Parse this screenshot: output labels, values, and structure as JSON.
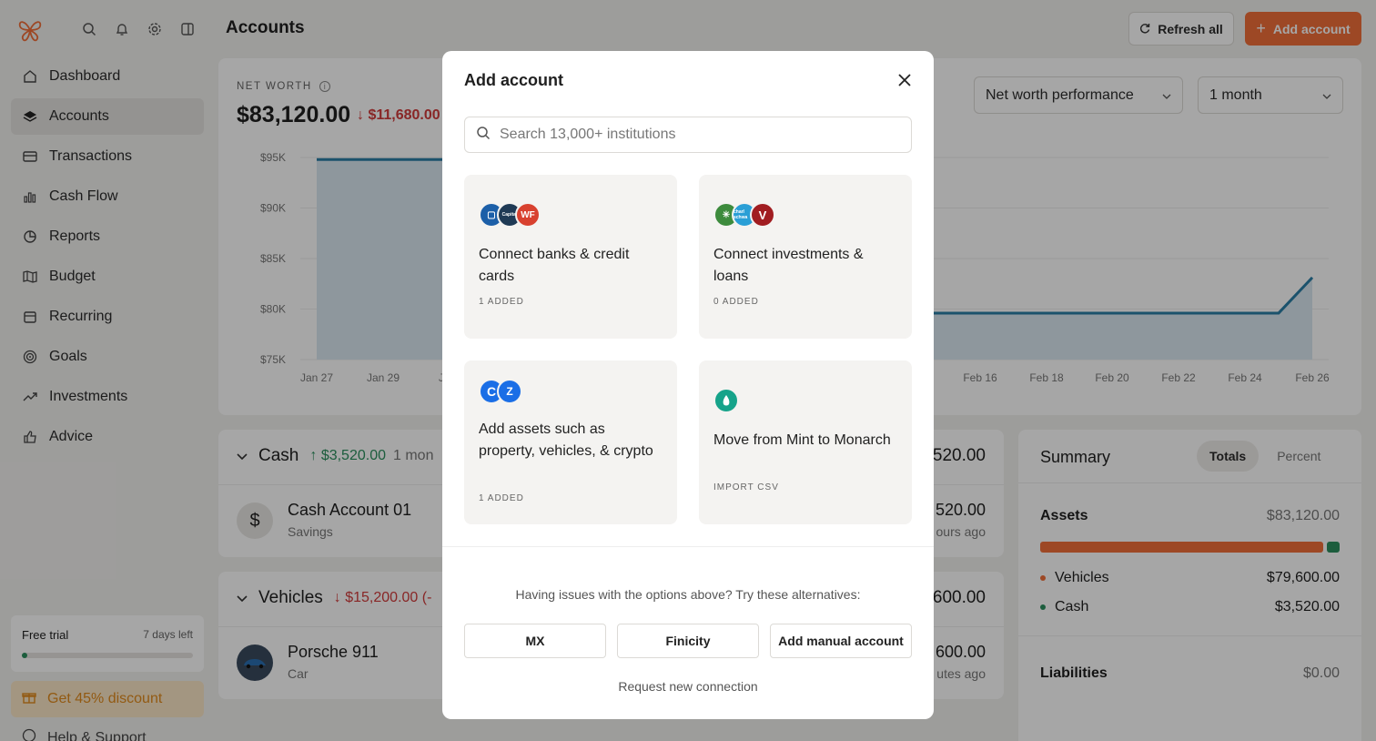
{
  "header": {
    "title": "Accounts",
    "refresh_label": "Refresh all",
    "add_label": "Add account"
  },
  "sidebar": {
    "items": [
      {
        "label": "Dashboard",
        "icon": "home-icon"
      },
      {
        "label": "Accounts",
        "icon": "layers-icon",
        "active": true
      },
      {
        "label": "Transactions",
        "icon": "credit-card-icon"
      },
      {
        "label": "Cash Flow",
        "icon": "bar-chart-icon"
      },
      {
        "label": "Reports",
        "icon": "pie-chart-icon"
      },
      {
        "label": "Budget",
        "icon": "map-icon"
      },
      {
        "label": "Recurring",
        "icon": "calendar-icon"
      },
      {
        "label": "Goals",
        "icon": "target-icon"
      },
      {
        "label": "Investments",
        "icon": "trend-up-icon"
      },
      {
        "label": "Advice",
        "icon": "thumbs-up-icon"
      }
    ],
    "trial": {
      "label": "Free trial",
      "days_left": "7 days left",
      "progress": 0.03
    },
    "discount_label": "Get 45% discount",
    "help_label": "Help & Support"
  },
  "net_worth": {
    "label": "NET WORTH",
    "value": "$83,120.00",
    "change": "$11,680.00",
    "performance_select": "Net worth performance",
    "period_select": "1 month"
  },
  "chart_data": {
    "type": "area",
    "y_ticks": [
      "$95K",
      "$90K",
      "$85K",
      "$80K",
      "$75K"
    ],
    "x_ticks_visible": [
      "Jan 27",
      "Jan 29",
      "Ja",
      "Feb 16",
      "Feb 18",
      "Feb 20",
      "Feb 22",
      "Feb 24",
      "Feb 26"
    ],
    "ylim": [
      75000,
      95000
    ],
    "series": [
      {
        "x": [
          "Jan 27",
          "Jan 29"
        ],
        "y": [
          94800,
          94800
        ]
      },
      {
        "x": [
          "Feb 16",
          "Feb 18",
          "Feb 20",
          "Feb 22",
          "Feb 24",
          "Feb 25",
          "Feb 26"
        ],
        "y": [
          79600,
          79600,
          79600,
          79600,
          79600,
          79600,
          83120
        ]
      }
    ],
    "line_color": "#2a7ea6",
    "fill_color": "#dbe9f2"
  },
  "groups": [
    {
      "name": "Cash",
      "change": "$3,520.00",
      "direction": "up",
      "period": "1 mon",
      "total": "520.00",
      "account": {
        "name": "Cash Account 01",
        "type": "Savings",
        "balance": "520.00",
        "updated": "ours ago",
        "avatar": "$"
      }
    },
    {
      "name": "Vehicles",
      "change": "$15,200.00 (-",
      "direction": "down",
      "period": "",
      "total": "600.00",
      "account": {
        "name": "Porsche 911",
        "type": "Car",
        "balance": "600.00",
        "updated": "utes ago",
        "avatar": "car"
      }
    }
  ],
  "summary": {
    "title": "Summary",
    "tabs": [
      "Totals",
      "Percent"
    ],
    "assets_label": "Assets",
    "assets_value": "$83,120.00",
    "assets_share_vehicles": 0.958,
    "items": [
      {
        "label": "Vehicles",
        "value": "$79,600.00",
        "color": "#f26f3a"
      },
      {
        "label": "Cash",
        "value": "$3,520.00",
        "color": "#2c8f5e"
      }
    ],
    "liabilities_label": "Liabilities",
    "liabilities_value": "$0.00"
  },
  "modal": {
    "title": "Add account",
    "search_placeholder": "Search 13,000+ institutions",
    "tiles": [
      {
        "title": "Connect banks & credit cards",
        "meta": "1 ADDED",
        "logos": [
          {
            "text": "",
            "color": "#1c5fa8"
          },
          {
            "text": "Capital",
            "color": "#1f3a55"
          },
          {
            "text": "WF",
            "color": "#d8412f"
          }
        ]
      },
      {
        "title": "Connect investments & loans",
        "meta": "0 ADDED",
        "logos": [
          {
            "text": "",
            "color": "#3d8b3d"
          },
          {
            "text": "charl schwa",
            "color": "#2a9fd6"
          },
          {
            "text": "V",
            "color": "#a11d21"
          }
        ]
      },
      {
        "title": "Add assets such as property, vehicles, & crypto",
        "meta": "1 ADDED",
        "logos": [
          {
            "text": "C",
            "color": "#1a6ee6"
          },
          {
            "text": "Z",
            "color": "#1a6ee6"
          }
        ]
      },
      {
        "title": "Move from Mint to Monarch",
        "meta": "IMPORT CSV",
        "logos": [
          {
            "text": "",
            "color": "#16a38a"
          }
        ]
      }
    ],
    "alternatives_text": "Having issues with the options above? Try these alternatives:",
    "alt_buttons": [
      "MX",
      "Finicity",
      "Add manual account"
    ],
    "request_label": "Request new connection"
  }
}
